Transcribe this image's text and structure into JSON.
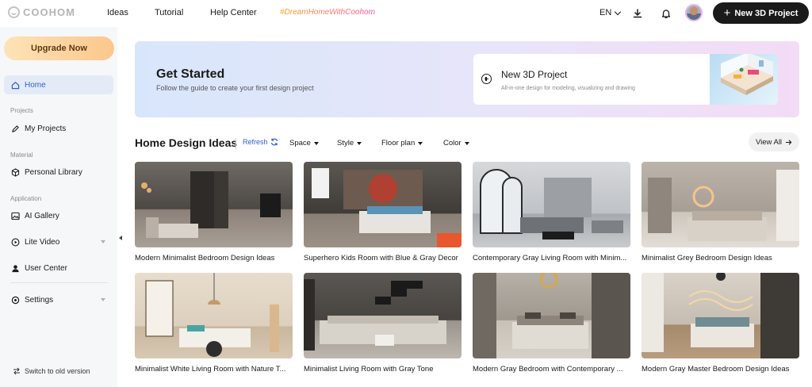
{
  "header": {
    "brand": "COOHOM",
    "nav": [
      "Ideas",
      "Tutorial",
      "Help Center"
    ],
    "hashtag": "#DreamHomeWithCoohom",
    "language": "EN",
    "new_project_label": "New 3D Project",
    "icons": [
      "logo-icon",
      "download-icon",
      "bell-icon",
      "avatar",
      "plus-icon"
    ]
  },
  "sidebar": {
    "upgrade_label": "Upgrade Now",
    "home_label": "Home",
    "sections": {
      "projects": "Projects",
      "material": "Material",
      "application": "Application"
    },
    "items": {
      "my_projects": "My Projects",
      "personal_library": "Personal Library",
      "ai_gallery": "AI Gallery",
      "lite_video": "Lite Video",
      "user_center": "User Center",
      "settings": "Settings"
    },
    "switch_label": "Switch to old version"
  },
  "banner": {
    "title": "Get Started",
    "subtitle": "Follow the guide to create your first design project",
    "card_title": "New 3D Project",
    "card_subtitle": "All-in-one design for modeling, visualizing and drawing"
  },
  "ideas": {
    "title": "Home Design Ideas",
    "refresh_label": "Refresh",
    "filters": [
      "Space",
      "Style",
      "Floor plan",
      "Color"
    ],
    "view_all_label": "View All",
    "cards": [
      "Modern Minimalist Bedroom Design Ideas",
      "Superhero Kids Room with Blue & Gray Decor",
      "Contemporary Gray Living Room with Minim...",
      "Minimalist Grey Bedroom Design Ideas",
      "Minimalist White Living Room with Nature T...",
      "Minimalist Living Room with Gray Tone",
      "Modern Gray Bedroom with Contemporary ...",
      "Modern Gray Master Bedroom Design Ideas"
    ]
  },
  "colors": {
    "accent_blue": "#2c5fd6",
    "primary_dark": "#1a1a1a",
    "upgrade_gradient_start": "#fde3b8",
    "upgrade_gradient_end": "#fcc78c",
    "active_nav_bg": "#e4ebf7"
  }
}
